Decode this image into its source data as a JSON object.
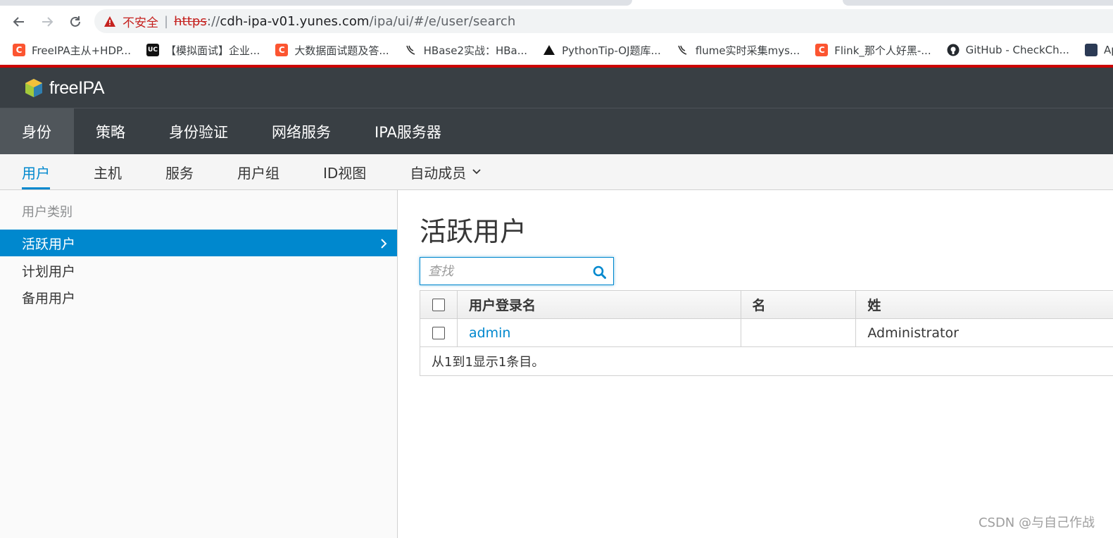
{
  "browser": {
    "security_label": "不安全",
    "url_scheme": "https",
    "url_sep": "://",
    "url_host": "cdh-ipa-v01.yunes.com",
    "url_path": "/ipa/ui/#/e/user/search"
  },
  "bookmarks": [
    {
      "label": "FreeIPA主从+HDP...",
      "icon": "C"
    },
    {
      "label": "【模拟面试】企业...",
      "icon": "UC"
    },
    {
      "label": "大数据面试题及答...",
      "icon": "C"
    },
    {
      "label": "HBase2实战：HBa...",
      "icon": "bird"
    },
    {
      "label": "PythonTip-OJ题库...",
      "icon": "triangle"
    },
    {
      "label": "flume实时采集mys...",
      "icon": "bird"
    },
    {
      "label": "Flink_那个人好黑-...",
      "icon": "C"
    },
    {
      "label": "GitHub - CheckCh...",
      "icon": "github"
    },
    {
      "label": "Apa",
      "icon": "avatar"
    }
  ],
  "app": {
    "brand": "freeIPA",
    "main_nav": [
      "身份",
      "策略",
      "身份验证",
      "网络服务",
      "IPA服务器"
    ],
    "sub_nav": [
      "用户",
      "主机",
      "服务",
      "用户组",
      "ID视图",
      "自动成员"
    ]
  },
  "sidebar": {
    "heading": "用户类别",
    "items": [
      "活跃用户",
      "计划用户",
      "备用用户"
    ]
  },
  "main": {
    "title": "活跃用户",
    "search_placeholder": "查找",
    "columns": [
      "用户登录名",
      "名",
      "姓"
    ],
    "rows": [
      {
        "login": "admin",
        "first": "",
        "last": "Administrator"
      }
    ],
    "footer": "从1到1显示1条目。"
  },
  "watermark": "CSDN @与自己作战",
  "colors": {
    "accent": "#0088ce",
    "header_bg": "#393f44",
    "alert_red": "#cc0000"
  }
}
